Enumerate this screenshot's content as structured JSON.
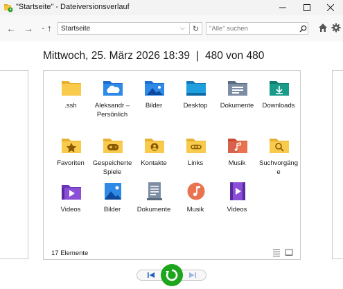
{
  "window": {
    "title": "\"Startseite\" - Dateiversionsverlauf"
  },
  "toolbar": {
    "address": "Startseite",
    "search_placeholder": "\"Alle\" suchen"
  },
  "header": {
    "date": "Mittwoch, 25. März 2026 18:39",
    "separator": "|",
    "version": "480 von 480"
  },
  "items": [
    {
      "label": ".ssh",
      "icon": "folder-icon"
    },
    {
      "label": "Aleksandr – Persönlich",
      "icon": "onedrive-folder-icon"
    },
    {
      "label": "Bilder",
      "icon": "pictures-folder-icon"
    },
    {
      "label": "Desktop",
      "icon": "desktop-folder-icon"
    },
    {
      "label": "Dokumente",
      "icon": "documents-folder-icon"
    },
    {
      "label": "Downloads",
      "icon": "downloads-folder-icon"
    },
    {
      "label": "Favoriten",
      "icon": "favorites-folder-icon"
    },
    {
      "label": "Gespeicherte Spiele",
      "icon": "saved-games-folder-icon"
    },
    {
      "label": "Kontakte",
      "icon": "contacts-folder-icon"
    },
    {
      "label": "Links",
      "icon": "links-folder-icon"
    },
    {
      "label": "Musik",
      "icon": "music-folder-icon"
    },
    {
      "label": "Suchvorgänge",
      "icon": "searches-folder-icon"
    },
    {
      "label": "Videos",
      "icon": "videos-folder-icon"
    },
    {
      "label": "Bilder",
      "icon": "pictures-library-icon"
    },
    {
      "label": "Dokumente",
      "icon": "documents-library-icon"
    },
    {
      "label": "Musik",
      "icon": "music-library-icon"
    },
    {
      "label": "Videos",
      "icon": "videos-library-icon"
    }
  ],
  "status": {
    "count": "17 Elemente"
  },
  "colors": {
    "folder_yellow": "#f6c445",
    "folder_blue": "#2e8ae6",
    "folder_teal": "#1a9b8a",
    "restore_green": "#1ea51e"
  }
}
